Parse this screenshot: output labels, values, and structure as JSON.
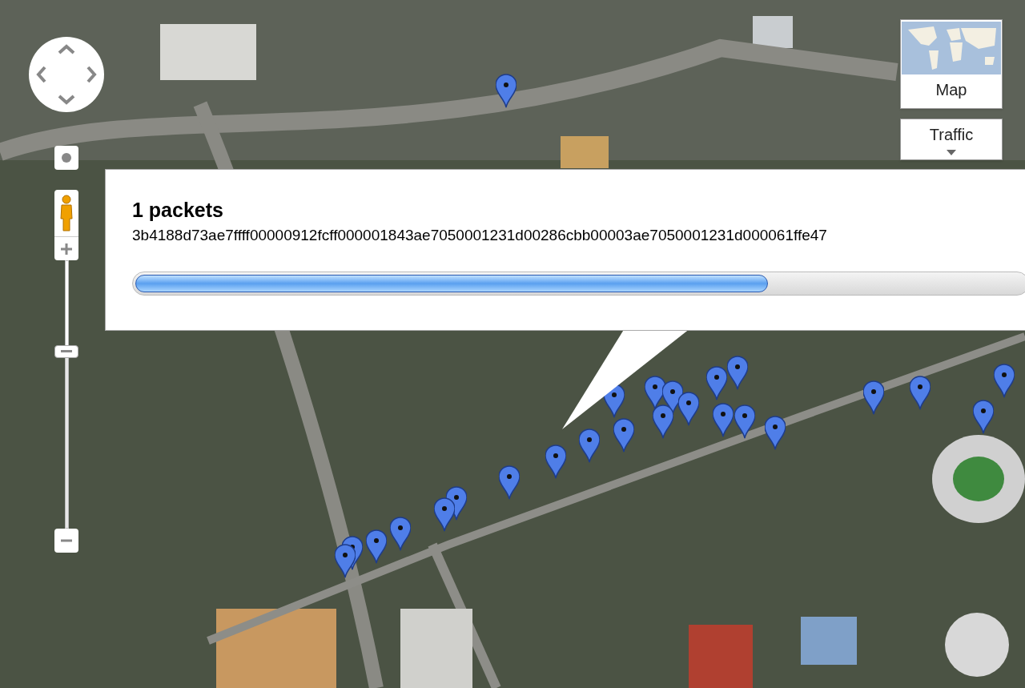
{
  "info_window": {
    "title": "1 packets",
    "packet_data": "3b4188d73ae7ffff00000912fcff000001843ae7050001231d00286cbb00003ae7050001231d000061ffe47"
  },
  "map_type": {
    "buttons": [
      {
        "label": "Map",
        "kind": "thumbnail"
      },
      {
        "label": "Traffic",
        "kind": "dropdown"
      }
    ]
  },
  "zoom": {
    "level": 0.66
  }
}
